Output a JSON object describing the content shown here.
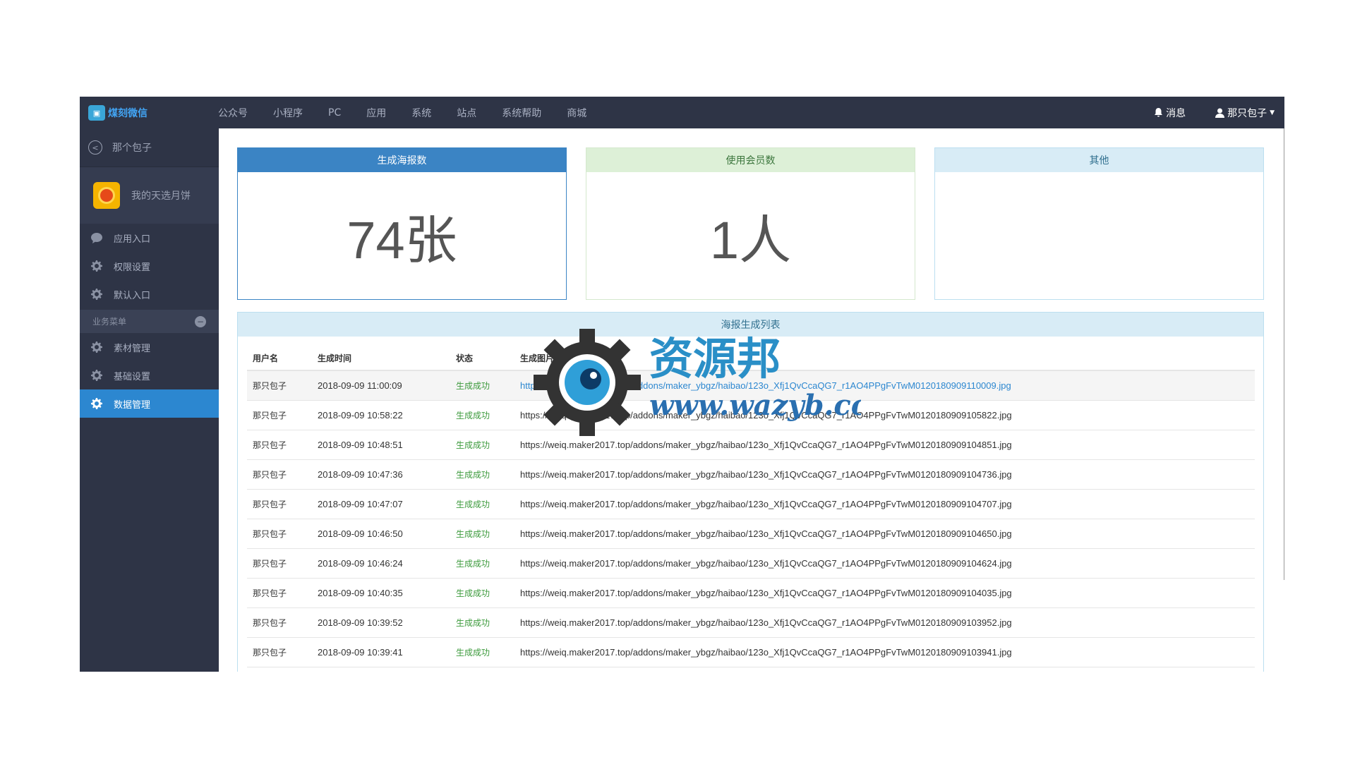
{
  "topbar": {
    "logo_text": "煤刻微信",
    "nav": [
      "公众号",
      "小程序",
      "PC",
      "应用",
      "系统",
      "站点",
      "系统帮助",
      "商城"
    ],
    "messages_label": "消息",
    "user_label": "那只包子"
  },
  "sidebar": {
    "back_label": "那个包子",
    "account_name": "我的天选月饼",
    "items": [
      {
        "label": "应用入口",
        "icon": "chat-icon"
      },
      {
        "label": "权限设置",
        "icon": "gear-icon"
      },
      {
        "label": "默认入口",
        "icon": "gear-icon"
      }
    ],
    "group_label": "业务菜单",
    "group_toggle": "−",
    "group_items": [
      {
        "label": "素材管理",
        "icon": "gear-icon",
        "active": false
      },
      {
        "label": "基础设置",
        "icon": "gear-icon",
        "active": false
      },
      {
        "label": "数据管理",
        "icon": "gear-icon",
        "active": true
      }
    ]
  },
  "cards": [
    {
      "title": "生成海报数",
      "value": "74张"
    },
    {
      "title": "使用会员数",
      "value": "1人"
    },
    {
      "title": "其他",
      "value": ""
    }
  ],
  "panel": {
    "title": "海报生成列表",
    "columns": [
      "用户名",
      "生成时间",
      "状态",
      "生成图片"
    ],
    "rows": [
      {
        "user": "那只包子",
        "time": "2018-09-09 11:00:09",
        "status": "生成成功",
        "url": "https://weiq.maker2017.top/addons/maker_ybgz/haibao/123o_Xfj1QvCcaQG7_r1AO4PPgFvTwM0120180909110009.jpg"
      },
      {
        "user": "那只包子",
        "time": "2018-09-09 10:58:22",
        "status": "生成成功",
        "url": "https://weiq.maker2017.top/addons/maker_ybgz/haibao/123o_Xfj1QvCcaQG7_r1AO4PPgFvTwM0120180909105822.jpg"
      },
      {
        "user": "那只包子",
        "time": "2018-09-09 10:48:51",
        "status": "生成成功",
        "url": "https://weiq.maker2017.top/addons/maker_ybgz/haibao/123o_Xfj1QvCcaQG7_r1AO4PPgFvTwM0120180909104851.jpg"
      },
      {
        "user": "那只包子",
        "time": "2018-09-09 10:47:36",
        "status": "生成成功",
        "url": "https://weiq.maker2017.top/addons/maker_ybgz/haibao/123o_Xfj1QvCcaQG7_r1AO4PPgFvTwM0120180909104736.jpg"
      },
      {
        "user": "那只包子",
        "time": "2018-09-09 10:47:07",
        "status": "生成成功",
        "url": "https://weiq.maker2017.top/addons/maker_ybgz/haibao/123o_Xfj1QvCcaQG7_r1AO4PPgFvTwM0120180909104707.jpg"
      },
      {
        "user": "那只包子",
        "time": "2018-09-09 10:46:50",
        "status": "生成成功",
        "url": "https://weiq.maker2017.top/addons/maker_ybgz/haibao/123o_Xfj1QvCcaQG7_r1AO4PPgFvTwM0120180909104650.jpg"
      },
      {
        "user": "那只包子",
        "time": "2018-09-09 10:46:24",
        "status": "生成成功",
        "url": "https://weiq.maker2017.top/addons/maker_ybgz/haibao/123o_Xfj1QvCcaQG7_r1AO4PPgFvTwM0120180909104624.jpg"
      },
      {
        "user": "那只包子",
        "time": "2018-09-09 10:40:35",
        "status": "生成成功",
        "url": "https://weiq.maker2017.top/addons/maker_ybgz/haibao/123o_Xfj1QvCcaQG7_r1AO4PPgFvTwM0120180909104035.jpg"
      },
      {
        "user": "那只包子",
        "time": "2018-09-09 10:39:52",
        "status": "生成成功",
        "url": "https://weiq.maker2017.top/addons/maker_ybgz/haibao/123o_Xfj1QvCcaQG7_r1AO4PPgFvTwM0120180909103952.jpg"
      },
      {
        "user": "那只包子",
        "time": "2018-09-09 10:39:41",
        "status": "生成成功",
        "url": "https://weiq.maker2017.top/addons/maker_ybgz/haibao/123o_Xfj1QvCcaQG7_r1AO4PPgFvTwM0120180909103941.jpg"
      }
    ]
  },
  "watermark": {
    "title": "资源邦",
    "url": "www.wazyb.com"
  },
  "colors": {
    "topbar_bg": "#2e3446",
    "active_item": "#2c87d0",
    "primary_card": "#3b84c4",
    "success_card": "#ddf0d7",
    "info_card": "#d8ecf6",
    "status_success": "#3c9a3c"
  }
}
